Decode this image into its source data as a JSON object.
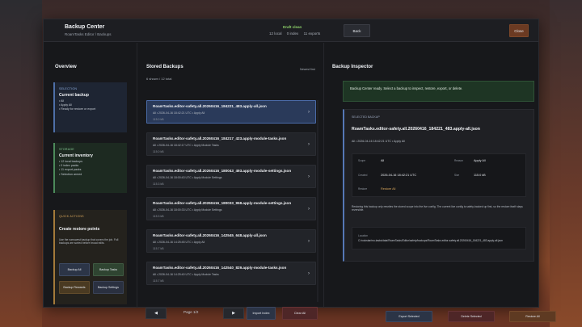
{
  "header": {
    "title": "Backup Center",
    "subtitle": "RoamTasks Editor / Backups",
    "status": "Draft clean",
    "counts": [
      "12 local",
      "0 index",
      "11 exports"
    ],
    "back_label": "Back",
    "close_label": "Close"
  },
  "overview": {
    "title": "Overview",
    "selection": {
      "label": "SELECTION",
      "heading": "Current backup",
      "lines": [
        "• All",
        "• Apply All",
        "• Ready for restore or export"
      ]
    },
    "storage": {
      "label": "STORAGE",
      "heading": "Current inventory",
      "lines": [
        "• 12 local backups",
        "• 0 index packs",
        "• 11 export packs",
        "• Selection armed"
      ]
    },
    "quick_actions": {
      "label": "QUICK ACTIONS",
      "heading": "Create restore points",
      "desc": "Use the narrowest backup that covers the job. Full backups are sorted before broad edits.",
      "buttons": [
        "Backup All",
        "Backup Tasks",
        "Backup Rewards",
        "Backup Settings"
      ]
    }
  },
  "stored": {
    "title": "Stored Backups",
    "count": "6 shown / 12 total",
    "sort": "Newest first",
    "items": [
      {
        "name": "RoamTasks.editor-safety.all.20260416_184221_483.apply-all.json",
        "meta": "All  •  2026-04-16 18:42:21 UTC  •  Apply All",
        "size": "115.0 kB",
        "selected": true
      },
      {
        "name": "RoamTasks.editor-safety.all.20260416_184217_423.apply-module-tasks.json",
        "meta": "All  •  2026-04-16 18:42:17 UTC  •  Apply Module Tasks",
        "size": "115.0 kB",
        "selected": false
      },
      {
        "name": "RoamTasks.editor-safety.all.20260416_180043_493.apply-module-settings.json",
        "meta": "All  •  2026-04-16 18:00:43 UTC  •  Apply Module Settings",
        "size": "115.3 kB",
        "selected": false
      },
      {
        "name": "RoamTasks.editor-safety.all.20260416_180033_958.apply-module-settings.json",
        "meta": "All  •  2026-04-16 18:00:33 UTC  •  Apply Module Settings",
        "size": "115.3 kB",
        "selected": false
      },
      {
        "name": "RoamTasks.editor-safety.all.20260416_142545_648.apply-all.json",
        "meta": "All  •  2026-04-16 14:25:45 UTC  •  Apply All",
        "size": "115.7 kB",
        "selected": false
      },
      {
        "name": "RoamTasks.editor-safety.all.20260416_142540_829.apply-module-tasks.json",
        "meta": "All  •  2026-04-16 14:25:40 UTC  •  Apply Module Tasks",
        "size": "115.7 kB",
        "selected": false
      }
    ],
    "prev_label": "◀",
    "next_label": "▶",
    "page_label": "Page 1/2",
    "import_label": "Import Index",
    "clear_label": "Clear All"
  },
  "inspector": {
    "title": "Backup Inspector",
    "banner": "Backup Center ready. Select a backup to inspect, restore, export, or delete.",
    "label": "SELECTED BACKUP",
    "name": "RoamTasks.editor-safety.all.20260416_184221_483.apply-all.json",
    "meta": "All  •  2026-04-16 18:42:21 UTC  •  Apply All",
    "fields": {
      "scope_k": "Scope",
      "scope_v": "All",
      "reason_k": "Reason",
      "reason_v": "Apply All",
      "created_k": "Created",
      "created_v": "2026-04-16 18:42:21 UTC",
      "size_k": "Size",
      "size_v": "115.0 kB",
      "restore_k": "Restore",
      "restore_v": "Restore All"
    },
    "note": "Restoring this backup only rewrites the stored scope into the live config. The current live config is safety-backed up first, so the restore itself stays reversible.",
    "location_k": "Location",
    "location_v": "C:/rockstar/mo-tasks/data/RoamTasks/Editor/safety/backups/RoamTasks.editor-safety.all.20260416_184221_483.apply-all.json",
    "export_label": "Export Selected",
    "delete_label": "Delete Selected",
    "restore_label": "Restore All"
  }
}
